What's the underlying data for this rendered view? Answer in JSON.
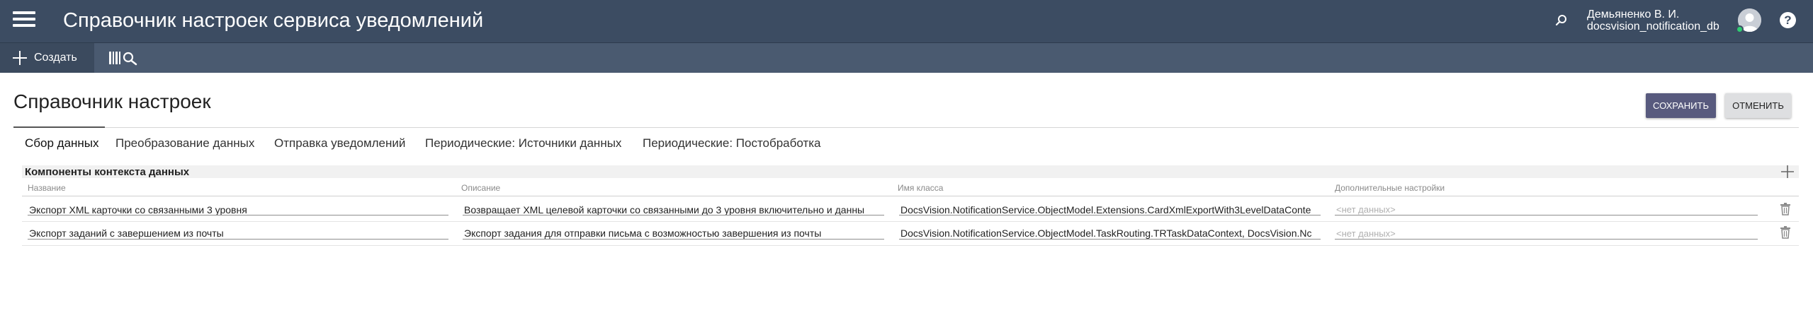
{
  "header": {
    "title": "Справочник настроек сервиса уведомлений",
    "user_name": "Демьяненко В. И.",
    "user_db": "docsvision_notification_db",
    "help_label": "?"
  },
  "toolbar": {
    "create_label": "Создать"
  },
  "page": {
    "title": "Справочник настроек",
    "save_label": "СОХРАНИТЬ",
    "cancel_label": "ОТМЕНИТЬ"
  },
  "tabs": [
    {
      "label": "Сбор данных",
      "active": true
    },
    {
      "label": "Преобразование данных",
      "active": false
    },
    {
      "label": "Отправка уведомлений",
      "active": false
    },
    {
      "label": "Периодические: Источники данных",
      "active": false
    },
    {
      "label": "Периодические: Постобработка",
      "active": false
    }
  ],
  "section": {
    "title": "Компоненты контекста данных",
    "columns": [
      "Название",
      "Описание",
      "Имя класса",
      "Дополнительные настройки"
    ],
    "rows": [
      {
        "name": "Экспорт XML карточки со связанными 3 уровня",
        "description": "Возвращает XML целевой карточки со связанными до 3 уровня включительно и данны",
        "class_name": "DocsVision.NotificationService.ObjectModel.Extensions.CardXmlExportWith3LevelDataConte",
        "settings_placeholder": "<нет данных>"
      },
      {
        "name": "Экспорт заданий с завершением из почты",
        "description": "Экспорт задания для отправки письма с возможностью завершения из почты",
        "class_name": "DocsVision.NotificationService.ObjectModel.TaskRouting.TRTaskDataContext, DocsVision.Nc",
        "settings_placeholder": "<нет данных>"
      }
    ]
  },
  "colors": {
    "header_bg": "#3c4c62",
    "toolbar_bg": "#4a5a70",
    "save_button": "#585a7e",
    "status_online": "#2ecc71"
  },
  "icons": [
    "hamburger-icon",
    "plus-icon",
    "library-search-icon",
    "search-icon",
    "avatar",
    "help-icon",
    "add-icon",
    "trash-icon"
  ]
}
